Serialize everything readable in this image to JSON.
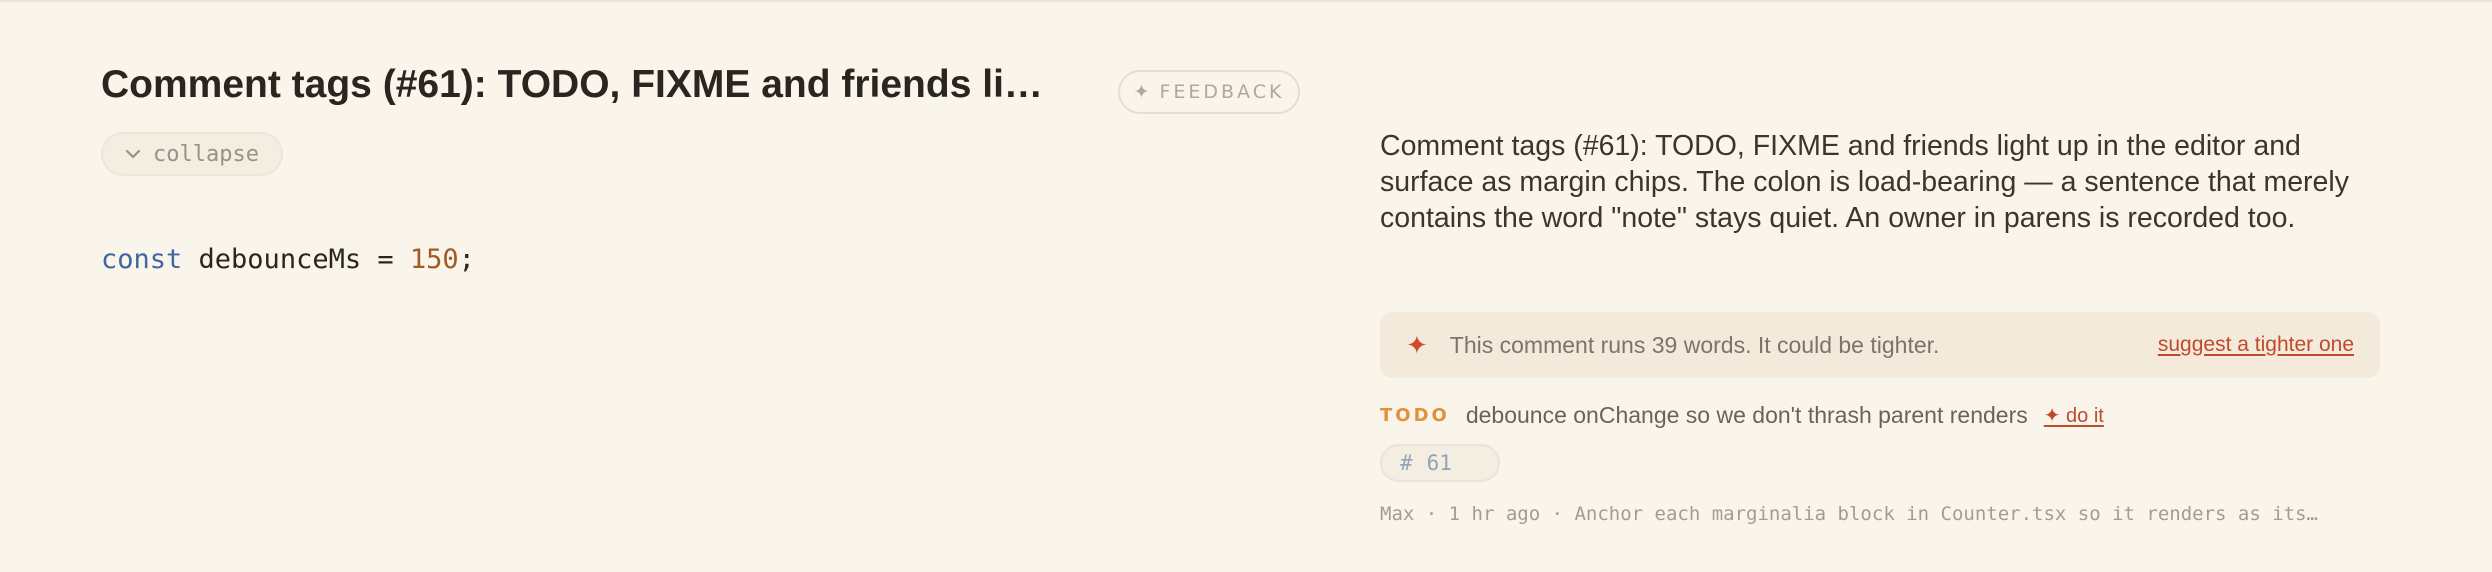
{
  "header": {
    "title": "Comment tags (#61): TODO, FIXME and friends lig…",
    "feedback_label": "FEEDBACK",
    "feedback_icon": "sparkle-icon",
    "collapse_label": "collapse",
    "collapse_icon": "chevron-down-icon"
  },
  "code": {
    "keyword": "const",
    "identifier": " debounceMs = ",
    "number": "150",
    "terminator": ";"
  },
  "comment": {
    "text": "Comment tags (#61): TODO, FIXME and friends light up in the editor and surface as margin chips. The colon is load-bearing — a sentence that merely contains the word \"note\" stays quiet. An owner in parens is recorded too."
  },
  "nudge": {
    "icon": "sparkle-icon",
    "message": "This comment runs 39 words. It could be tighter.",
    "action_label": "suggest a tighter one"
  },
  "todo": {
    "tag": "TODO",
    "text": "debounce onChange so we don't thrash parent renders",
    "action_label": "✦ do it"
  },
  "ref_chip": {
    "hash": "#",
    "number": "61"
  },
  "meta": {
    "text": "Max · 1 hr ago · Anchor each marginalia block in Counter.tsx so it renders as its…"
  },
  "colors": {
    "background": "#faf5eb",
    "keyword": "#3e67a3",
    "number": "#a35a24",
    "accent_red": "#c24a2c",
    "todo_orange": "#e0913e"
  }
}
